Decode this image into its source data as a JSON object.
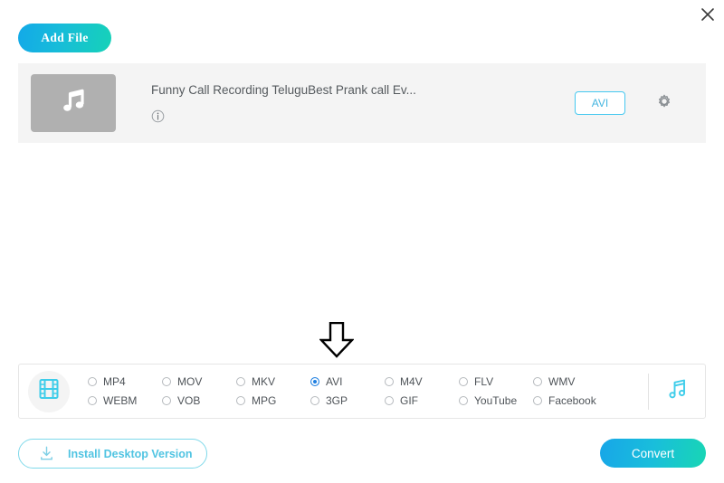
{
  "window": {
    "close_label": "close-icon"
  },
  "toolbar": {
    "add_file_label": "Add File"
  },
  "file_row": {
    "thumbnail_icon": "music-note-icon",
    "title": "Funny Call Recording TeluguBest Prank call Ev...",
    "info_icon": "info-icon",
    "output_format_badge": "AVI",
    "settings_icon": "gear-icon"
  },
  "annotation": {
    "arrow_icon": "down-arrow-icon"
  },
  "format_panel": {
    "video_tab_icon": "film-strip-icon",
    "audio_tab_icon": "music-note-icon",
    "selected": "AVI",
    "options": [
      {
        "label": "MP4",
        "selected": false
      },
      {
        "label": "MOV",
        "selected": false
      },
      {
        "label": "MKV",
        "selected": false
      },
      {
        "label": "AVI",
        "selected": true
      },
      {
        "label": "M4V",
        "selected": false
      },
      {
        "label": "FLV",
        "selected": false
      },
      {
        "label": "WMV",
        "selected": false
      },
      {
        "label": "WEBM",
        "selected": false
      },
      {
        "label": "VOB",
        "selected": false
      },
      {
        "label": "MPG",
        "selected": false
      },
      {
        "label": "3GP",
        "selected": false
      },
      {
        "label": "GIF",
        "selected": false
      },
      {
        "label": "YouTube",
        "selected": false
      },
      {
        "label": "Facebook",
        "selected": false
      }
    ]
  },
  "footer": {
    "install_label": "Install Desktop Version",
    "install_icon": "download-icon",
    "convert_label": "Convert"
  },
  "colors": {
    "accent_cyan": "#45c8f0",
    "accent_teal": "#18d6b4",
    "radio_selected_blue": "#1e7fe0",
    "panel_gray": "#f4f4f4",
    "thumb_gray": "#b0b0b0"
  }
}
